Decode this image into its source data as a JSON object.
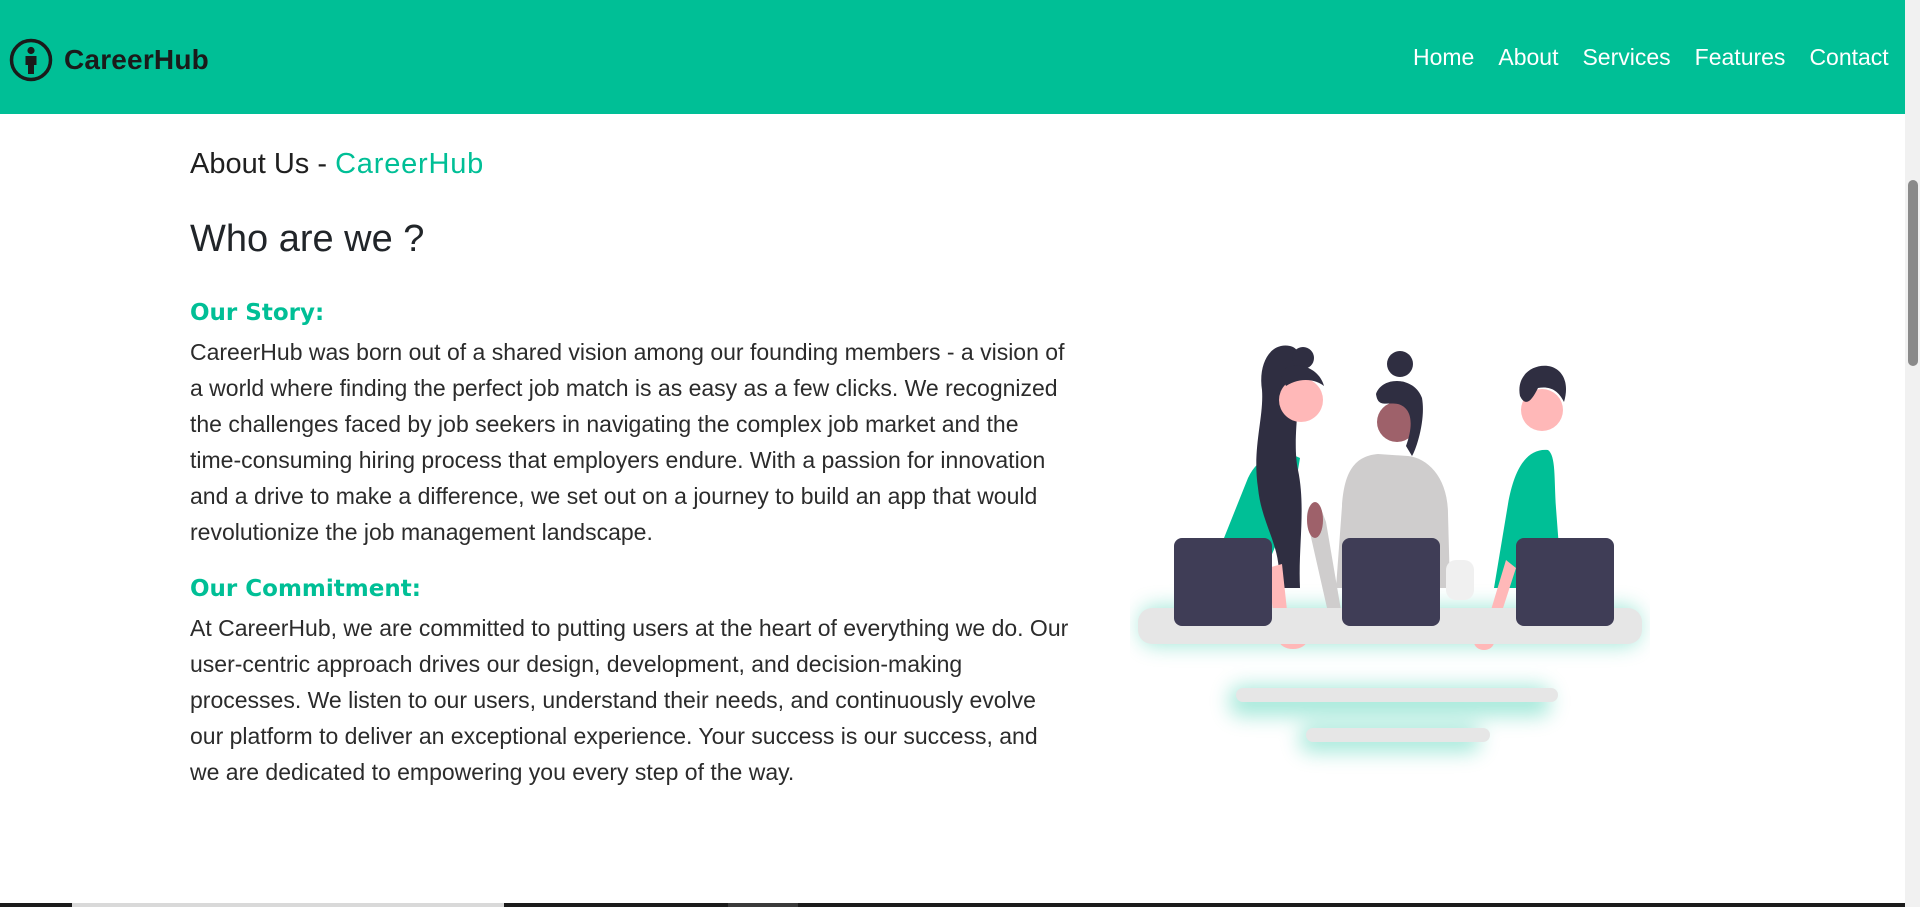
{
  "header": {
    "brand_name": "CareerHub",
    "brand_icon": "person-circle-icon",
    "nav_items": [
      {
        "label": "Home"
      },
      {
        "label": "About"
      },
      {
        "label": "Services"
      },
      {
        "label": "Features"
      },
      {
        "label": "Contact"
      }
    ]
  },
  "about": {
    "heading_prefix": "About Us - ",
    "heading_brand": "CareerHub",
    "section_title": "Who are we ?",
    "story": {
      "heading": "Our Story:",
      "text": "CareerHub was born out of a shared vision among our founding members - a vision of a world where finding the perfect job match is as easy as a few clicks. We recognized the challenges faced by job seekers in navigating the complex job market and the time-consuming hiring process that employers endure. With a passion for innovation and a drive to make a difference, we set out on a journey to build an app that would revolutionize the job management landscape."
    },
    "commitment": {
      "heading": "Our Commitment:",
      "text": "At CareerHub, we are committed to putting users at the heart of everything we do. Our user-centric approach drives our design, development, and decision-making processes. We listen to our users, understand their needs, and continuously evolve our platform to deliver an exceptional experience. Your success is our success, and we are dedicated to empowering you every step of the way."
    }
  },
  "colors": {
    "brand": "#00bf96",
    "text": "#212529",
    "laptop": "#3f3d56",
    "table": "#e6e6e6"
  }
}
